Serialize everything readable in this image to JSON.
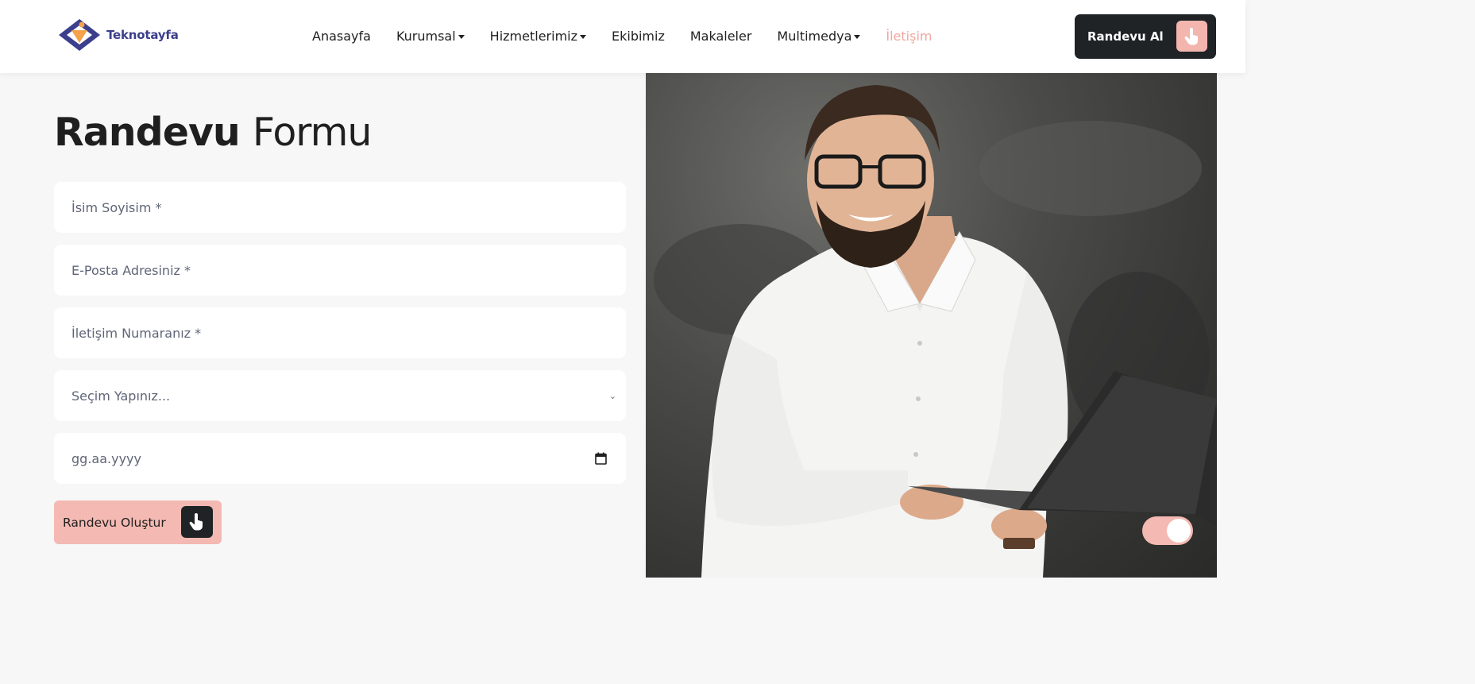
{
  "brand": {
    "name": "Teknotayfa"
  },
  "nav": {
    "items": [
      {
        "label": "Anasayfa",
        "dropdown": false,
        "active": false
      },
      {
        "label": "Kurumsal",
        "dropdown": true,
        "active": false
      },
      {
        "label": "Hizmetlerimiz",
        "dropdown": true,
        "active": false
      },
      {
        "label": "Ekibimiz",
        "dropdown": false,
        "active": false
      },
      {
        "label": "Makaleler",
        "dropdown": false,
        "active": false
      },
      {
        "label": "Multimedya",
        "dropdown": true,
        "active": false
      },
      {
        "label": "İletişim",
        "dropdown": false,
        "active": true
      }
    ],
    "cta_label": "Randevu Al",
    "cta_icon": "pointer-hand-icon"
  },
  "form": {
    "title_bold": "Randevu",
    "title_light": "Formu",
    "name_placeholder": "İsim Soyisim *",
    "email_placeholder": "E-Posta Adresiniz *",
    "phone_placeholder": "İletişim Numaranız *",
    "select_value": "Seçim Yapınız...",
    "date_value": "gg.aa.yyyy",
    "submit_label": "Randevu Oluştur",
    "submit_icon": "pointer-hand-icon"
  },
  "colors": {
    "accent": "#f3b9b2",
    "active_nav": "#f0a7a0",
    "dark": "#1f2326",
    "logo": "#3b3f8c"
  }
}
